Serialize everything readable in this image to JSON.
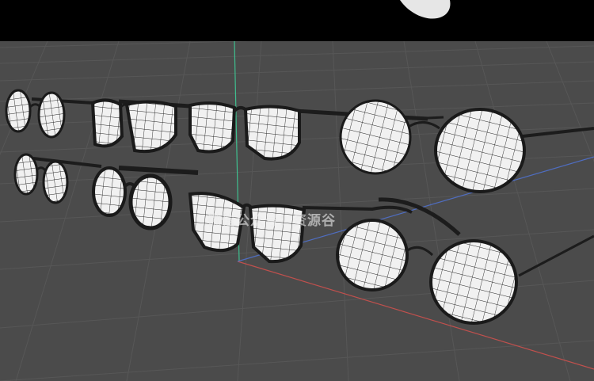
{
  "app": {
    "kind": "3d-modeling-viewport"
  },
  "top_bar": {
    "icon": "white-blob-icon"
  },
  "viewport": {
    "background_color": "#4b4b4b",
    "grid_color": "#575757",
    "axis_colors": {
      "x": "#c0504d",
      "y": "#3fbf8f",
      "z": "#4f6dc0"
    },
    "shading": "wireframe"
  },
  "objects": [
    {
      "name": "glasses-row1-small-oval"
    },
    {
      "name": "glasses-row1-square"
    },
    {
      "name": "glasses-row1-wayfarer"
    },
    {
      "name": "glasses-row1-round-large"
    },
    {
      "name": "glasses-row2-small-round"
    },
    {
      "name": "glasses-row2-round"
    },
    {
      "name": "glasses-row2-cat-eye"
    },
    {
      "name": "glasses-row2-round-metal"
    }
  ],
  "watermark": {
    "text": "微信公众号：资源谷"
  }
}
